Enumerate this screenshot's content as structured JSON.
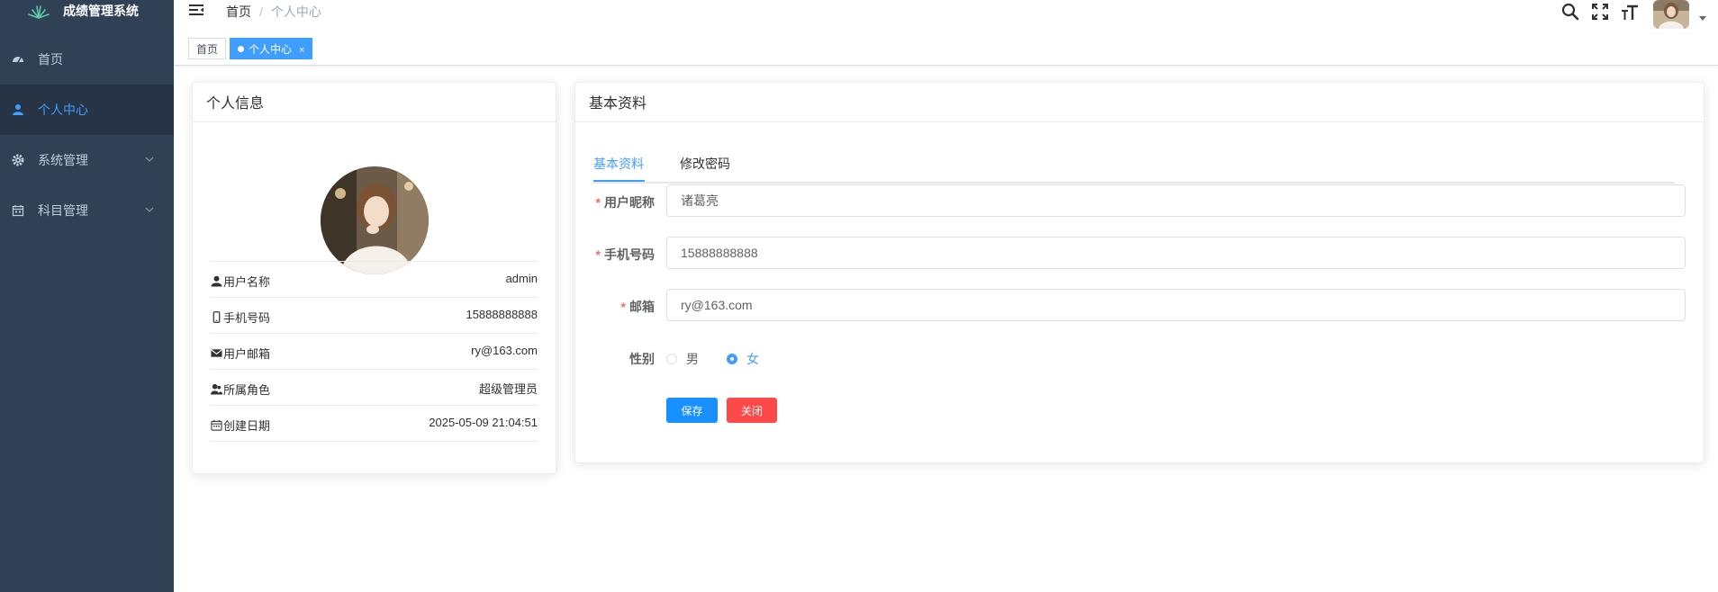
{
  "app": {
    "title": "成绩管理系统"
  },
  "sidebar": {
    "items": [
      {
        "label": "首页",
        "icon": "dashboard-icon"
      },
      {
        "label": "个人中心",
        "icon": "user-icon",
        "active": true
      },
      {
        "label": "系统管理",
        "icon": "gear-icon"
      },
      {
        "label": "科目管理",
        "icon": "calendar-icon"
      }
    ]
  },
  "navbar": {
    "breadcrumb": {
      "home": "首页",
      "separator": "/",
      "current": "个人中心"
    }
  },
  "tags": [
    {
      "label": "首页"
    },
    {
      "label": "个人中心",
      "active": true,
      "close": "×"
    }
  ],
  "profile": {
    "title": "个人信息",
    "rows": [
      {
        "label": "用户名称",
        "value": "admin"
      },
      {
        "label": "手机号码",
        "value": "15888888888"
      },
      {
        "label": "用户邮箱",
        "value": "ry@163.com"
      },
      {
        "label": "所属角色",
        "value": "超级管理员"
      },
      {
        "label": "创建日期",
        "value": "2025-05-09 21:04:51"
      }
    ]
  },
  "basic": {
    "title": "基本资料",
    "tabs": [
      "基本资料",
      "修改密码"
    ],
    "fields": {
      "nickname": {
        "label": "用户昵称",
        "value": "诸葛亮"
      },
      "phone": {
        "label": "手机号码",
        "value": "15888888888"
      },
      "email": {
        "label": "邮箱",
        "value": "ry@163.com"
      }
    },
    "gender": {
      "label": "性别",
      "options": [
        "男",
        "女"
      ],
      "selected": "女"
    },
    "buttons": {
      "save": "保存",
      "close": "关闭"
    }
  },
  "colors": {
    "sidebar": "#304156",
    "accent": "#409eff",
    "danger": "#ff4949"
  }
}
